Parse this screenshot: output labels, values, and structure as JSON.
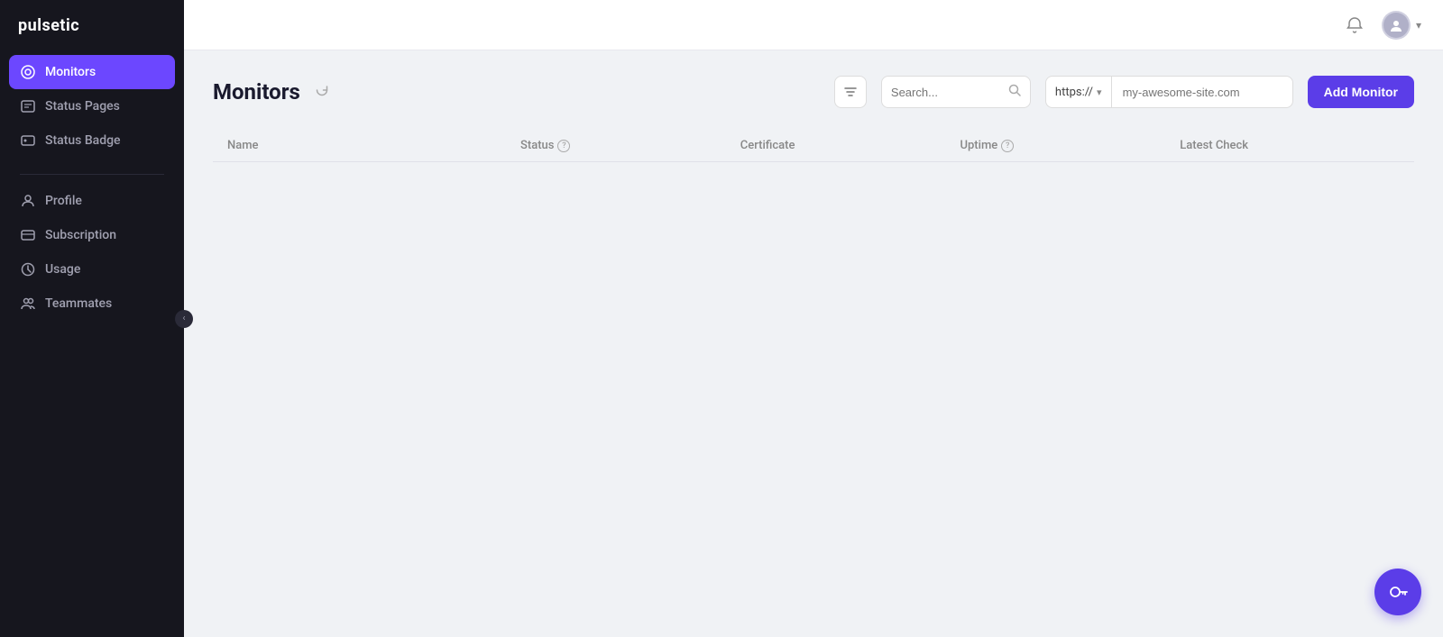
{
  "app": {
    "logo": "pulsetic"
  },
  "sidebar": {
    "items": [
      {
        "id": "monitors",
        "label": "Monitors",
        "active": true,
        "icon": "monitor-icon"
      },
      {
        "id": "status-pages",
        "label": "Status Pages",
        "active": false,
        "icon": "status-pages-icon"
      },
      {
        "id": "status-badge",
        "label": "Status Badge",
        "active": false,
        "icon": "status-badge-icon"
      }
    ],
    "secondary_items": [
      {
        "id": "profile",
        "label": "Profile",
        "icon": "profile-icon"
      },
      {
        "id": "subscription",
        "label": "Subscription",
        "icon": "subscription-icon"
      },
      {
        "id": "usage",
        "label": "Usage",
        "icon": "usage-icon"
      },
      {
        "id": "teammates",
        "label": "Teammates",
        "icon": "teammates-icon"
      }
    ]
  },
  "topbar": {
    "notification_icon": "bell-icon",
    "avatar_icon": "user-icon",
    "chevron_icon": "chevron-down-icon"
  },
  "content": {
    "title": "Monitors",
    "refresh_icon": "refresh-icon",
    "search_placeholder": "Search...",
    "url_prefix": "https://",
    "url_placeholder": "my-awesome-site.com",
    "add_button_label": "Add Monitor",
    "filter_icon": "filter-icon",
    "table_headers": [
      {
        "label": "Name",
        "has_info": false
      },
      {
        "label": "Status",
        "has_info": true
      },
      {
        "label": "Certificate",
        "has_info": false
      },
      {
        "label": "Uptime",
        "has_info": true
      },
      {
        "label": "Latest Check",
        "has_info": false
      }
    ]
  },
  "fab": {
    "icon": "key-icon"
  }
}
